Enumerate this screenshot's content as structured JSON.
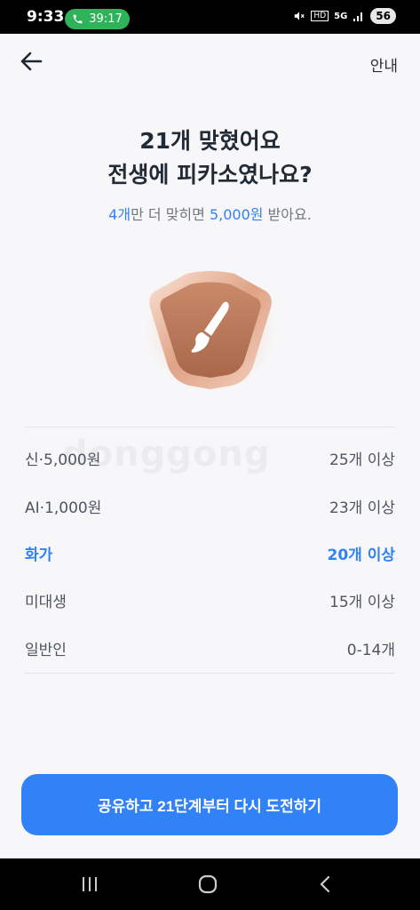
{
  "status_bar": {
    "time": "9:33",
    "call_timer": "39:17",
    "hd_label": "HD",
    "network_label": "5G",
    "battery": "56"
  },
  "nav": {
    "back_icon": "arrow-left-icon",
    "guide_label": "안내"
  },
  "headline": {
    "line1": "21개 맞혔어요",
    "line2": "전생에 피카소였나요?"
  },
  "subline": {
    "count": "4개",
    "mid": "만 더 맞히면 ",
    "amount": "5,000원",
    "end": " 받아요."
  },
  "badge": {
    "icon": "paintbrush-icon",
    "tier_color": "#c98a6a"
  },
  "tiers": [
    {
      "name": "신·5,000원",
      "requirement": "25개 이상",
      "active": false
    },
    {
      "name": "AI·1,000원",
      "requirement": "23개 이상",
      "active": false
    },
    {
      "name": "화가",
      "requirement": "20개 이상",
      "active": true
    },
    {
      "name": "미대생",
      "requirement": "15개 이상",
      "active": false
    },
    {
      "name": "일반인",
      "requirement": "0-14개",
      "active": false
    }
  ],
  "watermark": "donggong",
  "cta": {
    "label": "공유하고 21단계부터 다시 도전하기"
  },
  "colors": {
    "accent": "#3182f6",
    "background": "#f7f7f9"
  }
}
